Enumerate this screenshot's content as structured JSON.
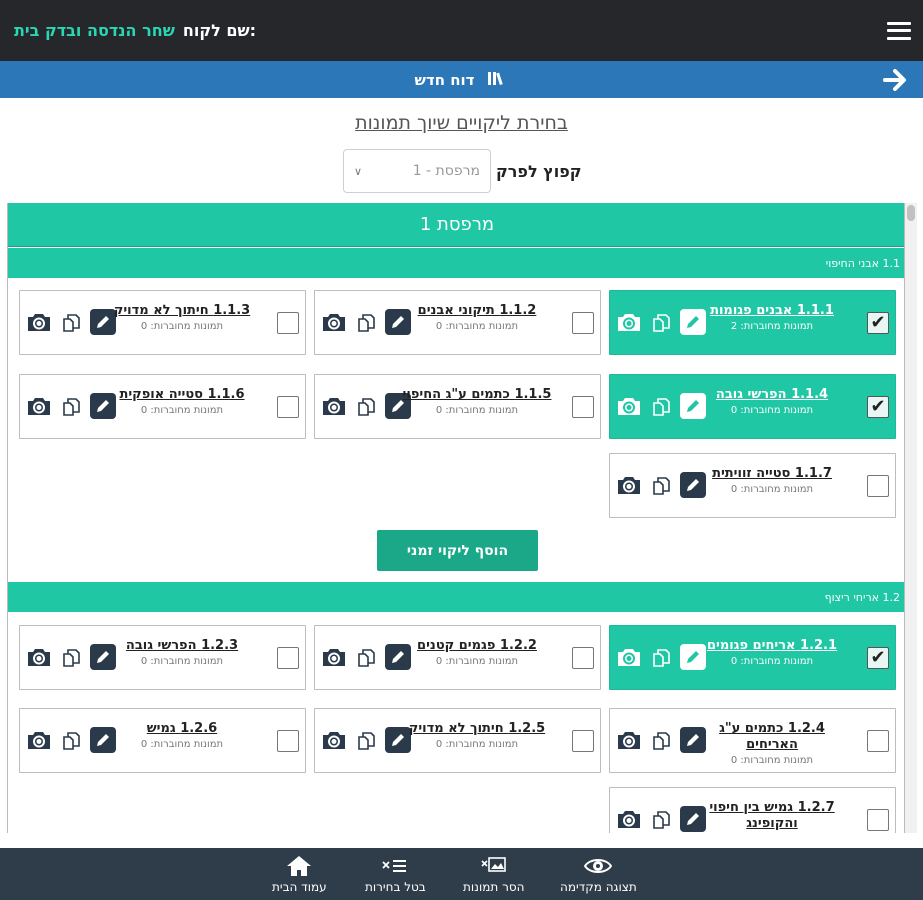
{
  "header": {
    "customer_label": "שם לקוח:",
    "customer_name": "שחר הנדסה ובדק בית"
  },
  "subheader": {
    "title": "דוח חדש"
  },
  "page_title": "בחירת ליקויים שיוך תמונות",
  "jump": {
    "label": "קפוץ לפרק",
    "selected": "1 - מרפסת"
  },
  "section": {
    "title": "מרפסת 1"
  },
  "groups": [
    {
      "title": "1.1 אבני החיפוי",
      "items": [
        {
          "title": "1.1.1 אבנים פגומות",
          "sub": "תמונות מחוברות: 2",
          "checked": true
        },
        {
          "title": "1.1.2 תיקוני אבנים",
          "sub": "תמונות מחוברות: 0",
          "checked": false
        },
        {
          "title": "1.1.3 חיתוך לא מדויק",
          "sub": "תמונות מחוברות: 0",
          "checked": false
        },
        {
          "title": "1.1.4 הפרשי גובה",
          "sub": "תמונות מחוברות: 0",
          "checked": true
        },
        {
          "title": "1.1.5 כתמים ע\"ג החיפוי",
          "sub": "תמונות מחוברות: 0",
          "checked": false
        },
        {
          "title": "1.1.6 סטייה אופקית",
          "sub": "תמונות מחוברות: 0",
          "checked": false
        },
        {
          "title": "1.1.7 סטייה זוויתית",
          "sub": "תמונות מחוברות: 0",
          "checked": false
        }
      ],
      "add_button": "הוסף ליקוי זמני"
    },
    {
      "title": "1.2 אריחי ריצוף",
      "items": [
        {
          "title": "1.2.1 אריחים פגומים",
          "sub": "תמונות מחוברות: 0",
          "checked": true
        },
        {
          "title": "1.2.2 פגמים קטנים",
          "sub": "תמונות מחוברות: 0",
          "checked": false
        },
        {
          "title": "1.2.3 הפרשי גובה",
          "sub": "תמונות מחוברות: 0",
          "checked": false
        },
        {
          "title": "1.2.4 כתמים ע\"ג האריחים",
          "sub": "תמונות מחוברות: 0",
          "checked": false
        },
        {
          "title": "1.2.5 חיתוך לא מדויק",
          "sub": "תמונות מחוברות: 0",
          "checked": false
        },
        {
          "title": "1.2.6 גמיש",
          "sub": "תמונות מחוברות: 0",
          "checked": false
        },
        {
          "title": "1.2.7 גמיש בין חיפוי והקופינג",
          "sub": "",
          "checked": false
        }
      ]
    }
  ],
  "bottom_nav": [
    {
      "label": "תצוגה מקדימה",
      "icon": "eye-icon"
    },
    {
      "label": "הסר תמונות",
      "icon": "images-remove-icon"
    },
    {
      "label": "בטל בחירות",
      "icon": "list-clear-icon"
    },
    {
      "label": "עמוד הבית",
      "icon": "home-icon"
    }
  ],
  "colors": {
    "accent": "#1fc7a5",
    "header": "#26272a",
    "blue": "#2c77b8",
    "nav": "#2f3d4b",
    "button": "#1aa889"
  }
}
